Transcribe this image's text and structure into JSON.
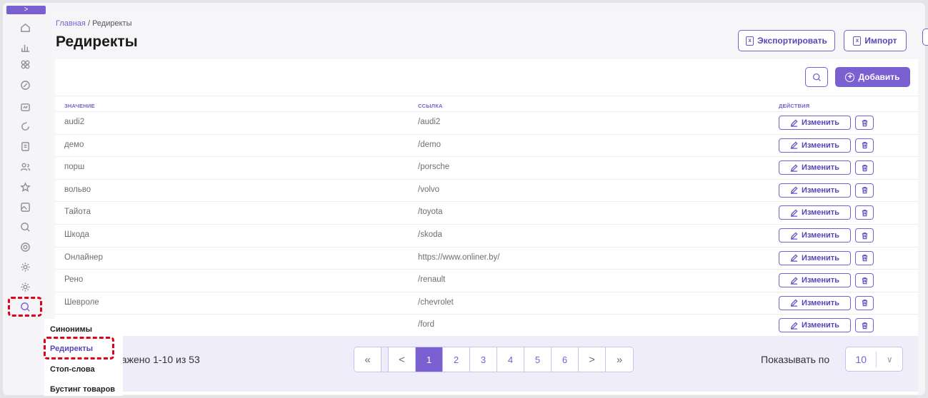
{
  "breadcrumb": {
    "home": "Главная",
    "separator": "/",
    "current": "Редиректы"
  },
  "page": {
    "title": "Редиректы"
  },
  "header_actions": {
    "export_label": "Экспортировать",
    "import_label": "Импорт"
  },
  "toolbar": {
    "add_label": "Добавить",
    "sidebar_toggle": ">"
  },
  "table": {
    "columns": [
      "ЗНАЧЕНИЕ",
      "ССЫЛКА",
      "ДЕЙСТВИЯ"
    ],
    "edit_label": "Изменить",
    "rows": [
      {
        "value": "audi2",
        "link": "/audi2"
      },
      {
        "value": "демо",
        "link": "/demo"
      },
      {
        "value": "порш",
        "link": "/porsche"
      },
      {
        "value": "вольво",
        "link": "/volvo"
      },
      {
        "value": "Тайота",
        "link": "/toyota"
      },
      {
        "value": "Шкода",
        "link": "/skoda"
      },
      {
        "value": "Онлайнер",
        "link": "https://www.onliner.by/"
      },
      {
        "value": "Рено",
        "link": "/renault"
      },
      {
        "value": "Шевроле",
        "link": "/chevrolet"
      },
      {
        "value": "",
        "link": "/ford"
      }
    ]
  },
  "pagination": {
    "showing_text": "ражено 1-10 из 53",
    "first": "«",
    "prev": "<",
    "pages": [
      "1",
      "2",
      "3",
      "4",
      "5",
      "6"
    ],
    "active_page": "1",
    "next": ">",
    "last": "»",
    "per_page_label": "Показывать по",
    "per_page_value": "10"
  },
  "submenu": {
    "items": [
      "Синонимы",
      "Редиректы",
      "Стоп-слова",
      "Бустинг товаров"
    ],
    "active": "Редиректы"
  },
  "sidebar": {
    "icons": [
      "home-icon",
      "chart-icon",
      "apps-icon",
      "discount-icon",
      "message-icon",
      "refresh-icon",
      "document-icon",
      "users-icon",
      "star-icon",
      "image-icon",
      "search-zoom-icon",
      "support-icon",
      "settings-icon",
      "settings-alt-icon",
      "search-icon"
    ]
  },
  "colors": {
    "accent": "#7a5fd0",
    "highlight": "#e0001a",
    "footer_bg": "#efedf9"
  }
}
